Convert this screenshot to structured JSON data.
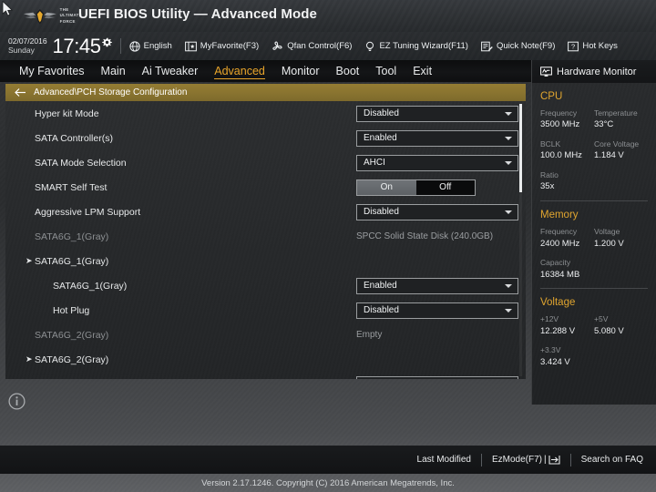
{
  "header": {
    "title": "UEFI BIOS Utility — Advanced Mode",
    "logo_line1": "THE",
    "logo_line2": "ULTIMATE",
    "logo_line3": "FORCE",
    "cursor_icon": "mouse-cursor-icon",
    "logo_icon": "tuf-wings-logo"
  },
  "infobar": {
    "date": "02/07/2016",
    "weekday": "Sunday",
    "time": "17:45",
    "gear_icon": "gear-icon",
    "buttons": [
      {
        "label": "English",
        "icon": "globe-icon"
      },
      {
        "label": "MyFavorite(F3)",
        "icon": "star-book-icon"
      },
      {
        "label": "Qfan Control(F6)",
        "icon": "fan-icon"
      },
      {
        "label": "EZ Tuning Wizard(F11)",
        "icon": "lightbulb-icon"
      },
      {
        "label": "Quick Note(F9)",
        "icon": "note-icon"
      },
      {
        "label": "Hot Keys",
        "icon": "question-box-icon"
      }
    ]
  },
  "tabs": [
    {
      "label": "My Favorites",
      "active": false
    },
    {
      "label": "Main",
      "active": false
    },
    {
      "label": "Ai Tweaker",
      "active": false
    },
    {
      "label": "Advanced",
      "active": true
    },
    {
      "label": "Monitor",
      "active": false
    },
    {
      "label": "Boot",
      "active": false
    },
    {
      "label": "Tool",
      "active": false
    },
    {
      "label": "Exit",
      "active": false
    }
  ],
  "breadcrumb": {
    "back_icon": "back-arrow-icon",
    "path": "Advanced\\PCH Storage Configuration"
  },
  "settings": [
    {
      "label": "Hyper kit Mode",
      "control": "dropdown",
      "value": "Disabled",
      "indent": 0,
      "dim": false,
      "arrow": false
    },
    {
      "label": "SATA Controller(s)",
      "control": "dropdown",
      "value": "Enabled",
      "indent": 0,
      "dim": false,
      "arrow": false
    },
    {
      "label": "SATA Mode Selection",
      "control": "dropdown",
      "value": "AHCI",
      "indent": 0,
      "dim": false,
      "arrow": false
    },
    {
      "label": "SMART Self Test",
      "control": "toggle",
      "on_label": "On",
      "off_label": "Off",
      "value": "On",
      "indent": 0,
      "dim": false,
      "arrow": false
    },
    {
      "label": "Aggressive LPM Support",
      "control": "dropdown",
      "value": "Disabled",
      "indent": 0,
      "dim": false,
      "arrow": false
    },
    {
      "label": "SATA6G_1(Gray)",
      "control": "text",
      "value": "SPCC Solid State Disk (240.0GB)",
      "indent": 0,
      "dim": true,
      "arrow": false
    },
    {
      "label": "SATA6G_1(Gray)",
      "control": "none",
      "value": "",
      "indent": 0,
      "dim": false,
      "arrow": true
    },
    {
      "label": "SATA6G_1(Gray)",
      "control": "dropdown",
      "value": "Enabled",
      "indent": 2,
      "dim": false,
      "arrow": false
    },
    {
      "label": "Hot Plug",
      "control": "dropdown",
      "value": "Disabled",
      "indent": 2,
      "dim": false,
      "arrow": false
    },
    {
      "label": "SATA6G_2(Gray)",
      "control": "text",
      "value": "Empty",
      "indent": 0,
      "dim": true,
      "arrow": false
    },
    {
      "label": "SATA6G_2(Gray)",
      "control": "none",
      "value": "",
      "indent": 0,
      "dim": false,
      "arrow": true
    },
    {
      "label": "",
      "control": "clipped",
      "value": "",
      "indent": 2,
      "dim": false,
      "arrow": false
    }
  ],
  "hardware_monitor": {
    "header": "Hardware Monitor",
    "header_icon": "monitor-icon",
    "sections": [
      {
        "title": "CPU",
        "pairs": [
          {
            "key": "Frequency",
            "value": "3500 MHz",
            "key2": "Temperature",
            "value2": "33°C"
          },
          {
            "key": "BCLK",
            "value": "100.0 MHz",
            "key2": "Core Voltage",
            "value2": "1.184 V"
          },
          {
            "key": "Ratio",
            "value": "35x",
            "key2": "",
            "value2": ""
          }
        ]
      },
      {
        "title": "Memory",
        "pairs": [
          {
            "key": "Frequency",
            "value": "2400 MHz",
            "key2": "Voltage",
            "value2": "1.200 V"
          },
          {
            "key": "Capacity",
            "value": "16384 MB",
            "key2": "",
            "value2": ""
          }
        ]
      },
      {
        "title": "Voltage",
        "pairs": [
          {
            "key": "+12V",
            "value": "12.288 V",
            "key2": "+5V",
            "value2": "5.080 V"
          },
          {
            "key": "+3.3V",
            "value": "3.424 V",
            "key2": "",
            "value2": ""
          }
        ]
      }
    ]
  },
  "bottom": {
    "info_icon": "info-circle-icon",
    "last_modified": "Last Modified",
    "ezmode": "EzMode(F7)",
    "ezmode_icon": "arrow-into-bracket-icon",
    "search_faq": "Search on FAQ",
    "version": "Version 2.17.1246. Copyright (C) 2016 American Megatrends, Inc."
  },
  "colors": {
    "accent_gold": "#e0a52f",
    "breadcrumb_gold": "#8a7430",
    "text_primary": "#eceef0",
    "text_dim": "#8c8f92"
  }
}
